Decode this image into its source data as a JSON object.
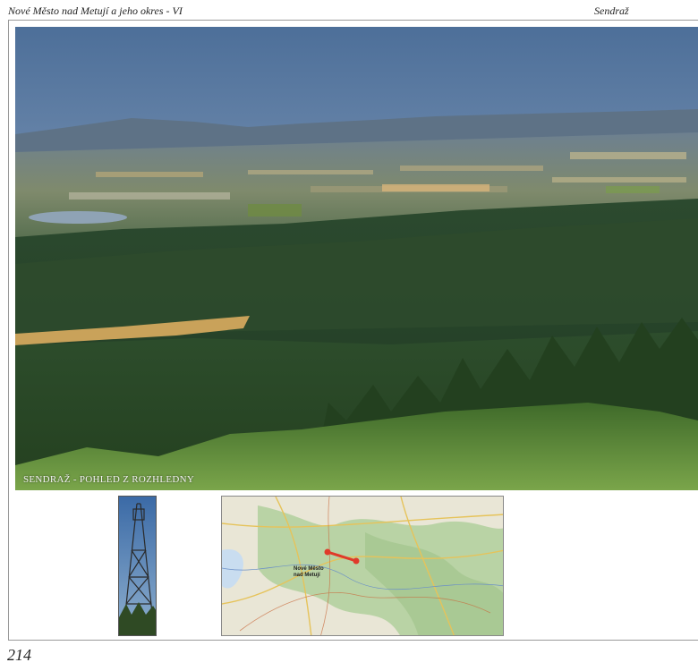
{
  "header": {
    "title": "Nové Město nad Metují a jeho okres - VI",
    "section": "Sendraž"
  },
  "photo": {
    "caption": "SENDRAŽ - POHLED Z ROZHLEDNY"
  },
  "map": {
    "town_label_line1": "Nové Město",
    "town_label_line2": "nad Metují"
  },
  "footer": {
    "page_number": "214"
  }
}
